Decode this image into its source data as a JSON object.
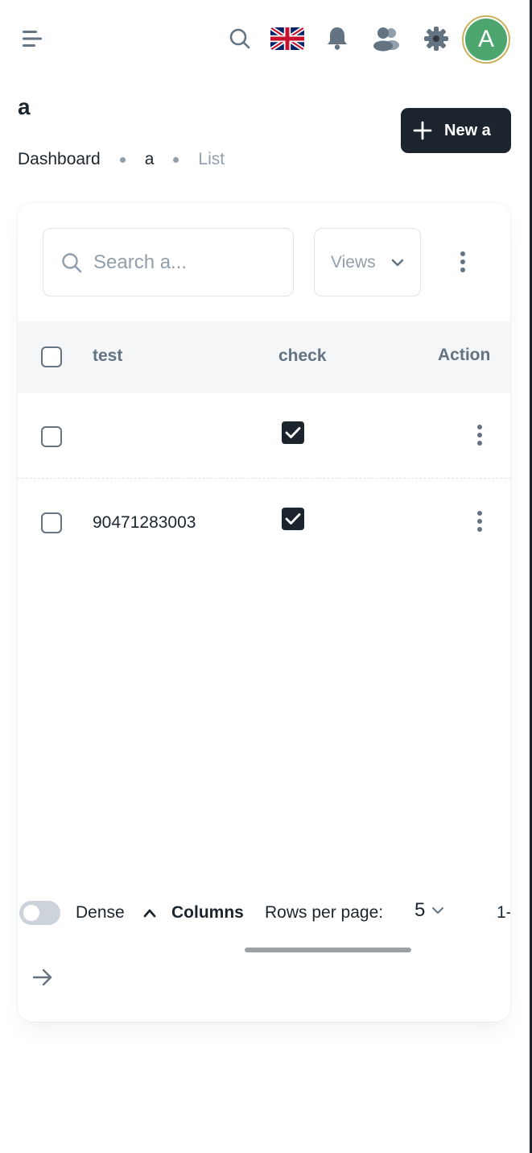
{
  "header": {
    "menu_icon": "menu-icon",
    "search_icon": "search-icon",
    "language": "UK flag",
    "notifications_icon": "bell-icon",
    "contacts_icon": "contacts-icon",
    "settings_icon": "gear-icon",
    "avatar_letter": "A"
  },
  "page": {
    "title": "a",
    "breadcrumbs": [
      "Dashboard",
      "a",
      "List"
    ],
    "new_button_label": "New a"
  },
  "toolbar": {
    "search_placeholder": "Search a...",
    "views_label": "Views"
  },
  "table": {
    "columns": [
      "test",
      "check",
      "Action"
    ],
    "rows": [
      {
        "test": "",
        "check": true
      },
      {
        "test": "90471283003",
        "check": true
      }
    ]
  },
  "footer": {
    "dense_label": "Dense",
    "dense_on": false,
    "columns_label": "Columns",
    "rows_per_page_label": "Rows per page:",
    "rows_per_page_value": "5",
    "range_text": "1-"
  },
  "colors": {
    "primary_dark": "#1c252e",
    "avatar_bg": "#4ca66e",
    "muted": "#919eab",
    "header_bg": "#f4f6f8"
  }
}
